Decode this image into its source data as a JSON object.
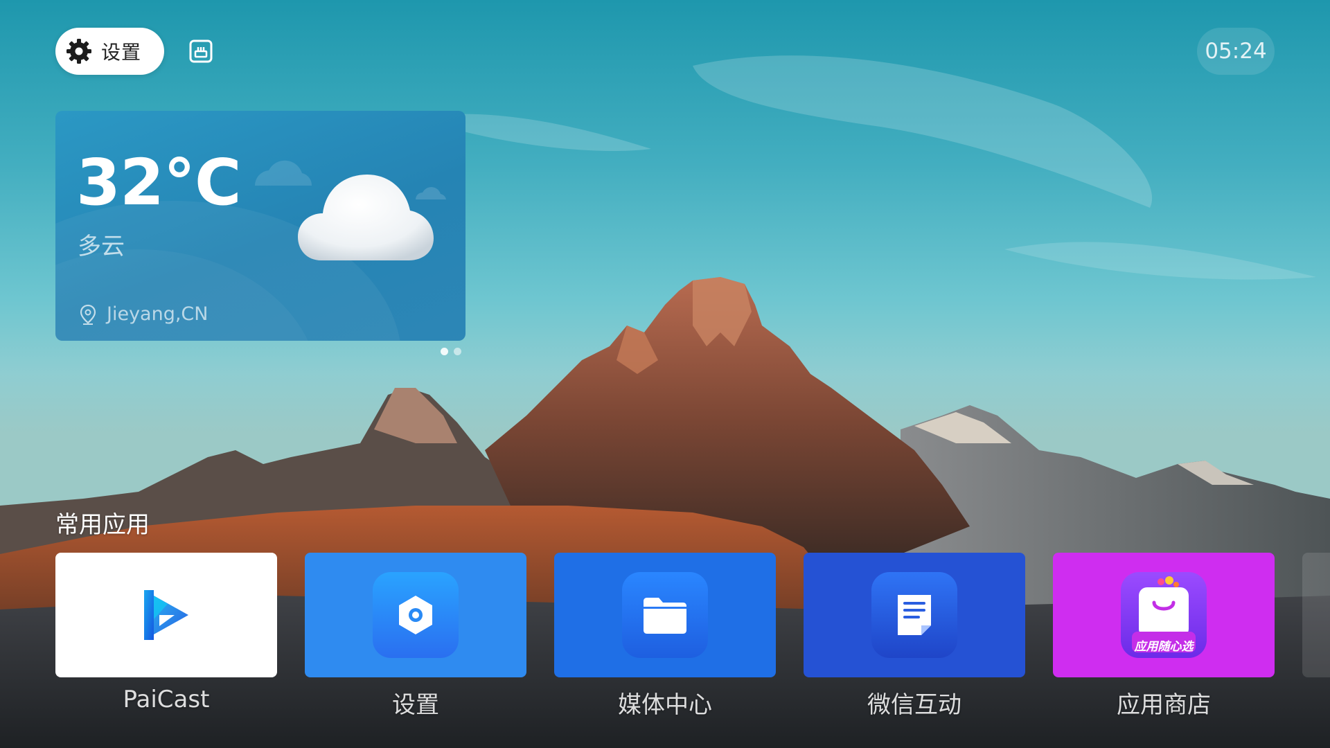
{
  "topbar": {
    "settings_label": "设置",
    "clock": "05:24",
    "network_icon": "network-icon"
  },
  "weather": {
    "temperature": "32°C",
    "condition": "多云",
    "location": "Jieyang,CN",
    "icon": "cloud-icon",
    "pages": 2,
    "active_page": 1
  },
  "apps": {
    "section_title": "常用应用",
    "items": [
      {
        "label": "PaiCast",
        "tile_color": "#ffffff",
        "icon": "paicast-icon"
      },
      {
        "label": "设置",
        "tile_color": "#2f8bf0",
        "icon": "settings-hex-icon"
      },
      {
        "label": "媒体中心",
        "tile_color": "#1f6fe6",
        "icon": "folder-icon"
      },
      {
        "label": "微信互动",
        "tile_color": "#2552d4",
        "icon": "document-icon"
      },
      {
        "label": "应用商店",
        "tile_color": "#cf2df0",
        "icon": "shopping-bag-icon",
        "badge_text": "应用随心选"
      }
    ]
  }
}
